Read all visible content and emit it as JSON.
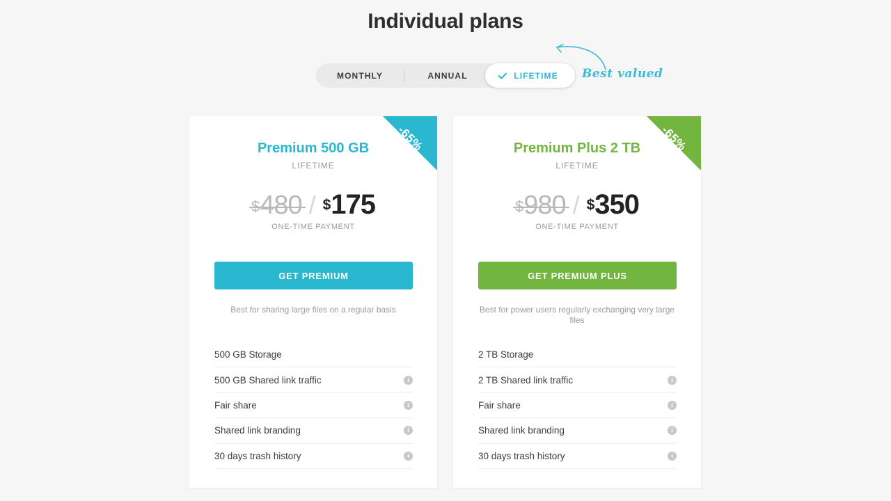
{
  "page": {
    "title": "Individual plans",
    "background_color": "#f6f6f6"
  },
  "billing_toggle": {
    "options": [
      {
        "label": "MONTHLY",
        "selected": false
      },
      {
        "label": "ANNUAL",
        "selected": false
      },
      {
        "label": "LIFETIME",
        "selected": true
      }
    ],
    "selected": "LIFETIME",
    "check_icon": "check-icon",
    "annotation": "Best valued",
    "annotation_color": "#3dbcd6"
  },
  "plans": [
    {
      "name": "Premium 500 GB",
      "accent_color": "#2ab8d1",
      "period": "LIFETIME",
      "discount_badge": "-65%",
      "old_price": "480",
      "new_price": "175",
      "currency": "$",
      "payment_note": "ONE-TIME PAYMENT",
      "cta_label": "GET PREMIUM",
      "tagline": "Best for sharing large files on a regular basis",
      "features": [
        {
          "label": "500 GB Storage",
          "info": false
        },
        {
          "label": "500 GB Shared link traffic",
          "info": true
        },
        {
          "label": "Fair share",
          "info": true
        },
        {
          "label": "Shared link branding",
          "info": true
        },
        {
          "label": "30 days trash history",
          "info": true
        }
      ]
    },
    {
      "name": "Premium Plus 2 TB",
      "accent_color": "#72b63f",
      "period": "LIFETIME",
      "discount_badge": "-65%",
      "old_price": "980",
      "new_price": "350",
      "currency": "$",
      "payment_note": "ONE-TIME PAYMENT",
      "cta_label": "GET PREMIUM PLUS",
      "tagline": "Best for power users regularly exchanging very large files",
      "features": [
        {
          "label": "2 TB Storage",
          "info": false
        },
        {
          "label": "2 TB Shared link traffic",
          "info": true
        },
        {
          "label": "Fair share",
          "info": true
        },
        {
          "label": "Shared link branding",
          "info": true
        },
        {
          "label": "30 days trash history",
          "info": true
        }
      ]
    }
  ],
  "icons": {
    "info": "i"
  }
}
